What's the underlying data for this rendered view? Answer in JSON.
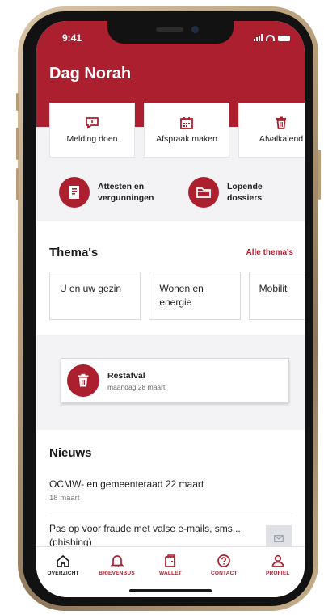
{
  "status_bar": {
    "time": "9:41"
  },
  "header": {
    "greeting": "Dag Norah"
  },
  "quick_actions": [
    {
      "label": "Melding doen",
      "icon": "report-icon"
    },
    {
      "label": "Afspraak maken",
      "icon": "calendar-icon"
    },
    {
      "label": "Afvalkalend",
      "icon": "trash-icon"
    }
  ],
  "shortcuts": [
    {
      "line1": "Attesten en",
      "line2": "vergunningen",
      "icon": "document-icon"
    },
    {
      "line1": "Lopende",
      "line2": "dossiers",
      "icon": "folder-icon"
    }
  ],
  "themas": {
    "title": "Thema's",
    "all_link": "Alle thema's",
    "cards": [
      {
        "line1": "U en uw gezin",
        "line2": ""
      },
      {
        "line1": "Wonen en",
        "line2": "energie"
      },
      {
        "line1": "Mobilit",
        "line2": ""
      }
    ]
  },
  "afval": {
    "title": "Restafval",
    "date": "maandag 28 maart",
    "icon": "trash-icon"
  },
  "news": {
    "title": "Nieuws",
    "items": [
      {
        "title": "OCMW- en gemeenteraad 22 maart",
        "date": "18 maart"
      },
      {
        "title": "Pas op voor fraude met valse e-mails, sms... (phishing)",
        "date": ""
      }
    ]
  },
  "tabs": [
    {
      "label": "OVERZICHT",
      "icon": "home-icon",
      "active": true
    },
    {
      "label": "BRIEVENBUS",
      "icon": "bell-icon",
      "active": false
    },
    {
      "label": "WALLET",
      "icon": "wallet-icon",
      "active": false
    },
    {
      "label": "CONTACT",
      "icon": "help-icon",
      "active": false
    },
    {
      "label": "PROFIEL",
      "icon": "user-icon",
      "active": false
    }
  ],
  "colors": {
    "brand": "#ab1f2f",
    "background": "#f3f3f5"
  }
}
